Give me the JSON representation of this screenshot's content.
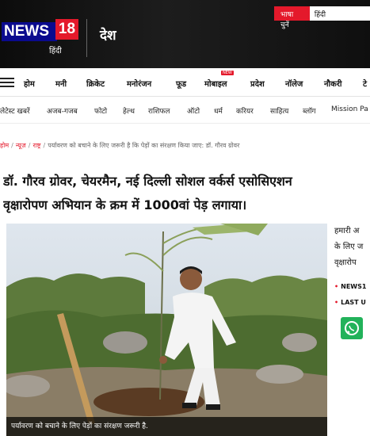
{
  "header": {
    "lang_label": "भाषा चुनें",
    "lang_value": "हिंदी",
    "logo_text": "NEWS",
    "logo_number": "18",
    "logo_hindi": "हिंदी",
    "section_title": "देश"
  },
  "nav": {
    "items": [
      "होम",
      "मनी",
      "क्रिकेट",
      "मनोरंजन",
      "फूड",
      "मोबाइल",
      "प्रदेश",
      "नॉलेज",
      "नौकरी",
      "टे"
    ],
    "new_badge": "NEW"
  },
  "subnav": {
    "items": [
      "लेटेस्ट खबरें",
      "अजब-गजब",
      "फोटो",
      "हेल्थ",
      "राशिफल",
      "ऑटो",
      "धर्म",
      "करियर",
      "साहित्य",
      "ब्लॉग",
      "Mission Pa"
    ]
  },
  "breadcrumb": {
    "items": [
      "होम",
      "न्यूज़",
      "राष्ट्र"
    ],
    "current": "पर्यावरण को बचाने के लिए जरूरी है कि पेड़ों का संरक्षण किया जाए: डॉ. गौरव ग्रोवर"
  },
  "article": {
    "headline_line1": "डॉ. गौरव ग्रोवर, चेयरमैन, नई दिल्ली सोशल वर्कर्स एसोसिएशन",
    "headline_line2": "वृक्षारोपण अभियान के क्रम में 1000वां पेड़ लगाया।",
    "image_caption": "पर्यावरण को बचाने के लिए पेड़ों का संरक्षण जरूरी है."
  },
  "rail": {
    "lines": [
      "हमारी अ",
      "के लिए ज",
      "वृक्षारोप"
    ],
    "links": [
      "NEWS1",
      "LAST U"
    ]
  },
  "colors": {
    "brand_red": "#e4192b",
    "brand_blue": "#0a0a8e",
    "whatsapp_green": "#22b25a"
  },
  "icons": [
    "menu-icon",
    "whatsapp-icon"
  ]
}
